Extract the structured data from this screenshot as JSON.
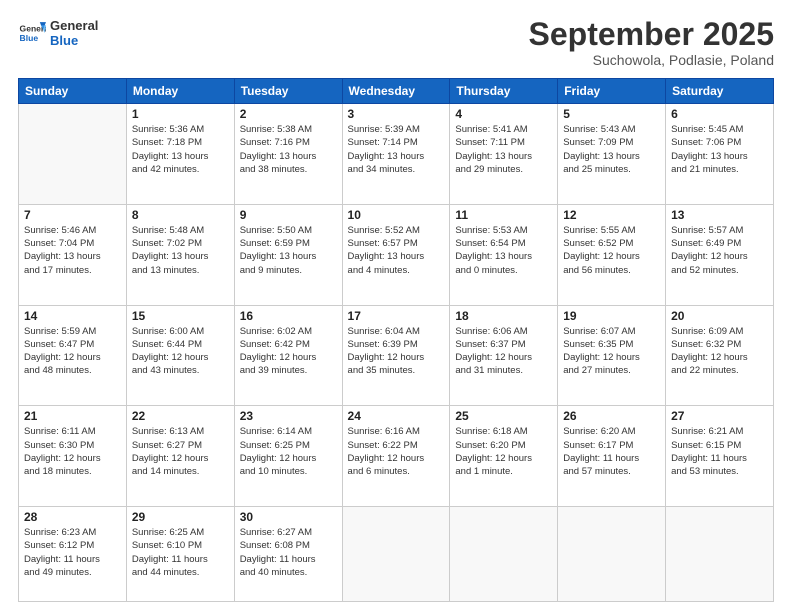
{
  "logo": {
    "line1": "General",
    "line2": "Blue"
  },
  "title": "September 2025",
  "subtitle": "Suchowola, Podlasie, Poland",
  "days_of_week": [
    "Sunday",
    "Monday",
    "Tuesday",
    "Wednesday",
    "Thursday",
    "Friday",
    "Saturday"
  ],
  "weeks": [
    [
      {
        "day": "",
        "info": ""
      },
      {
        "day": "1",
        "info": "Sunrise: 5:36 AM\nSunset: 7:18 PM\nDaylight: 13 hours\nand 42 minutes."
      },
      {
        "day": "2",
        "info": "Sunrise: 5:38 AM\nSunset: 7:16 PM\nDaylight: 13 hours\nand 38 minutes."
      },
      {
        "day": "3",
        "info": "Sunrise: 5:39 AM\nSunset: 7:14 PM\nDaylight: 13 hours\nand 34 minutes."
      },
      {
        "day": "4",
        "info": "Sunrise: 5:41 AM\nSunset: 7:11 PM\nDaylight: 13 hours\nand 29 minutes."
      },
      {
        "day": "5",
        "info": "Sunrise: 5:43 AM\nSunset: 7:09 PM\nDaylight: 13 hours\nand 25 minutes."
      },
      {
        "day": "6",
        "info": "Sunrise: 5:45 AM\nSunset: 7:06 PM\nDaylight: 13 hours\nand 21 minutes."
      }
    ],
    [
      {
        "day": "7",
        "info": "Sunrise: 5:46 AM\nSunset: 7:04 PM\nDaylight: 13 hours\nand 17 minutes."
      },
      {
        "day": "8",
        "info": "Sunrise: 5:48 AM\nSunset: 7:02 PM\nDaylight: 13 hours\nand 13 minutes."
      },
      {
        "day": "9",
        "info": "Sunrise: 5:50 AM\nSunset: 6:59 PM\nDaylight: 13 hours\nand 9 minutes."
      },
      {
        "day": "10",
        "info": "Sunrise: 5:52 AM\nSunset: 6:57 PM\nDaylight: 13 hours\nand 4 minutes."
      },
      {
        "day": "11",
        "info": "Sunrise: 5:53 AM\nSunset: 6:54 PM\nDaylight: 13 hours\nand 0 minutes."
      },
      {
        "day": "12",
        "info": "Sunrise: 5:55 AM\nSunset: 6:52 PM\nDaylight: 12 hours\nand 56 minutes."
      },
      {
        "day": "13",
        "info": "Sunrise: 5:57 AM\nSunset: 6:49 PM\nDaylight: 12 hours\nand 52 minutes."
      }
    ],
    [
      {
        "day": "14",
        "info": "Sunrise: 5:59 AM\nSunset: 6:47 PM\nDaylight: 12 hours\nand 48 minutes."
      },
      {
        "day": "15",
        "info": "Sunrise: 6:00 AM\nSunset: 6:44 PM\nDaylight: 12 hours\nand 43 minutes."
      },
      {
        "day": "16",
        "info": "Sunrise: 6:02 AM\nSunset: 6:42 PM\nDaylight: 12 hours\nand 39 minutes."
      },
      {
        "day": "17",
        "info": "Sunrise: 6:04 AM\nSunset: 6:39 PM\nDaylight: 12 hours\nand 35 minutes."
      },
      {
        "day": "18",
        "info": "Sunrise: 6:06 AM\nSunset: 6:37 PM\nDaylight: 12 hours\nand 31 minutes."
      },
      {
        "day": "19",
        "info": "Sunrise: 6:07 AM\nSunset: 6:35 PM\nDaylight: 12 hours\nand 27 minutes."
      },
      {
        "day": "20",
        "info": "Sunrise: 6:09 AM\nSunset: 6:32 PM\nDaylight: 12 hours\nand 22 minutes."
      }
    ],
    [
      {
        "day": "21",
        "info": "Sunrise: 6:11 AM\nSunset: 6:30 PM\nDaylight: 12 hours\nand 18 minutes."
      },
      {
        "day": "22",
        "info": "Sunrise: 6:13 AM\nSunset: 6:27 PM\nDaylight: 12 hours\nand 14 minutes."
      },
      {
        "day": "23",
        "info": "Sunrise: 6:14 AM\nSunset: 6:25 PM\nDaylight: 12 hours\nand 10 minutes."
      },
      {
        "day": "24",
        "info": "Sunrise: 6:16 AM\nSunset: 6:22 PM\nDaylight: 12 hours\nand 6 minutes."
      },
      {
        "day": "25",
        "info": "Sunrise: 6:18 AM\nSunset: 6:20 PM\nDaylight: 12 hours\nand 1 minute."
      },
      {
        "day": "26",
        "info": "Sunrise: 6:20 AM\nSunset: 6:17 PM\nDaylight: 11 hours\nand 57 minutes."
      },
      {
        "day": "27",
        "info": "Sunrise: 6:21 AM\nSunset: 6:15 PM\nDaylight: 11 hours\nand 53 minutes."
      }
    ],
    [
      {
        "day": "28",
        "info": "Sunrise: 6:23 AM\nSunset: 6:12 PM\nDaylight: 11 hours\nand 49 minutes."
      },
      {
        "day": "29",
        "info": "Sunrise: 6:25 AM\nSunset: 6:10 PM\nDaylight: 11 hours\nand 44 minutes."
      },
      {
        "day": "30",
        "info": "Sunrise: 6:27 AM\nSunset: 6:08 PM\nDaylight: 11 hours\nand 40 minutes."
      },
      {
        "day": "",
        "info": ""
      },
      {
        "day": "",
        "info": ""
      },
      {
        "day": "",
        "info": ""
      },
      {
        "day": "",
        "info": ""
      }
    ]
  ]
}
